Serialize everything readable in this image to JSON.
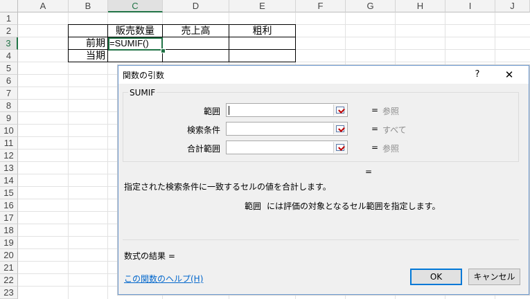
{
  "sheet": {
    "columns": [
      "A",
      "B",
      "C",
      "D",
      "E",
      "F",
      "G",
      "H",
      "I",
      "J"
    ],
    "rows": [
      "1",
      "2",
      "3",
      "4",
      "5",
      "6",
      "7",
      "8",
      "9",
      "10",
      "11",
      "12",
      "13",
      "14",
      "15",
      "16",
      "17",
      "18",
      "19",
      "20",
      "21",
      "22",
      "23"
    ],
    "headers": {
      "qty": "販売数量",
      "sales": "売上高",
      "profit": "粗利"
    },
    "row_labels": {
      "current": "前期",
      "this_period": "当期"
    },
    "active_formula": "=SUMIF()",
    "accent": "#217346"
  },
  "dialog": {
    "title": "関数の引数",
    "help_label": "?",
    "close_label": "✕",
    "function_name": "SUMIF",
    "args": [
      {
        "label": "範囲",
        "value": "",
        "eq": "=",
        "hint": "参照"
      },
      {
        "label": "検索条件",
        "value": "",
        "eq": "=",
        "hint": "すべて"
      },
      {
        "label": "合計範囲",
        "value": "",
        "eq": "=",
        "hint": "参照"
      }
    ],
    "result_eq": "=",
    "description": "指定された検索条件に一致するセルの値を合計します。",
    "arg_desc_name": "範囲",
    "arg_desc_text": "には評価の対象となるセル範囲を指定します。",
    "formula_result": "数式の結果 =",
    "help_link": "この関数のヘルプ(H)",
    "ok_label": "OK",
    "cancel_label": "キャンセル"
  }
}
